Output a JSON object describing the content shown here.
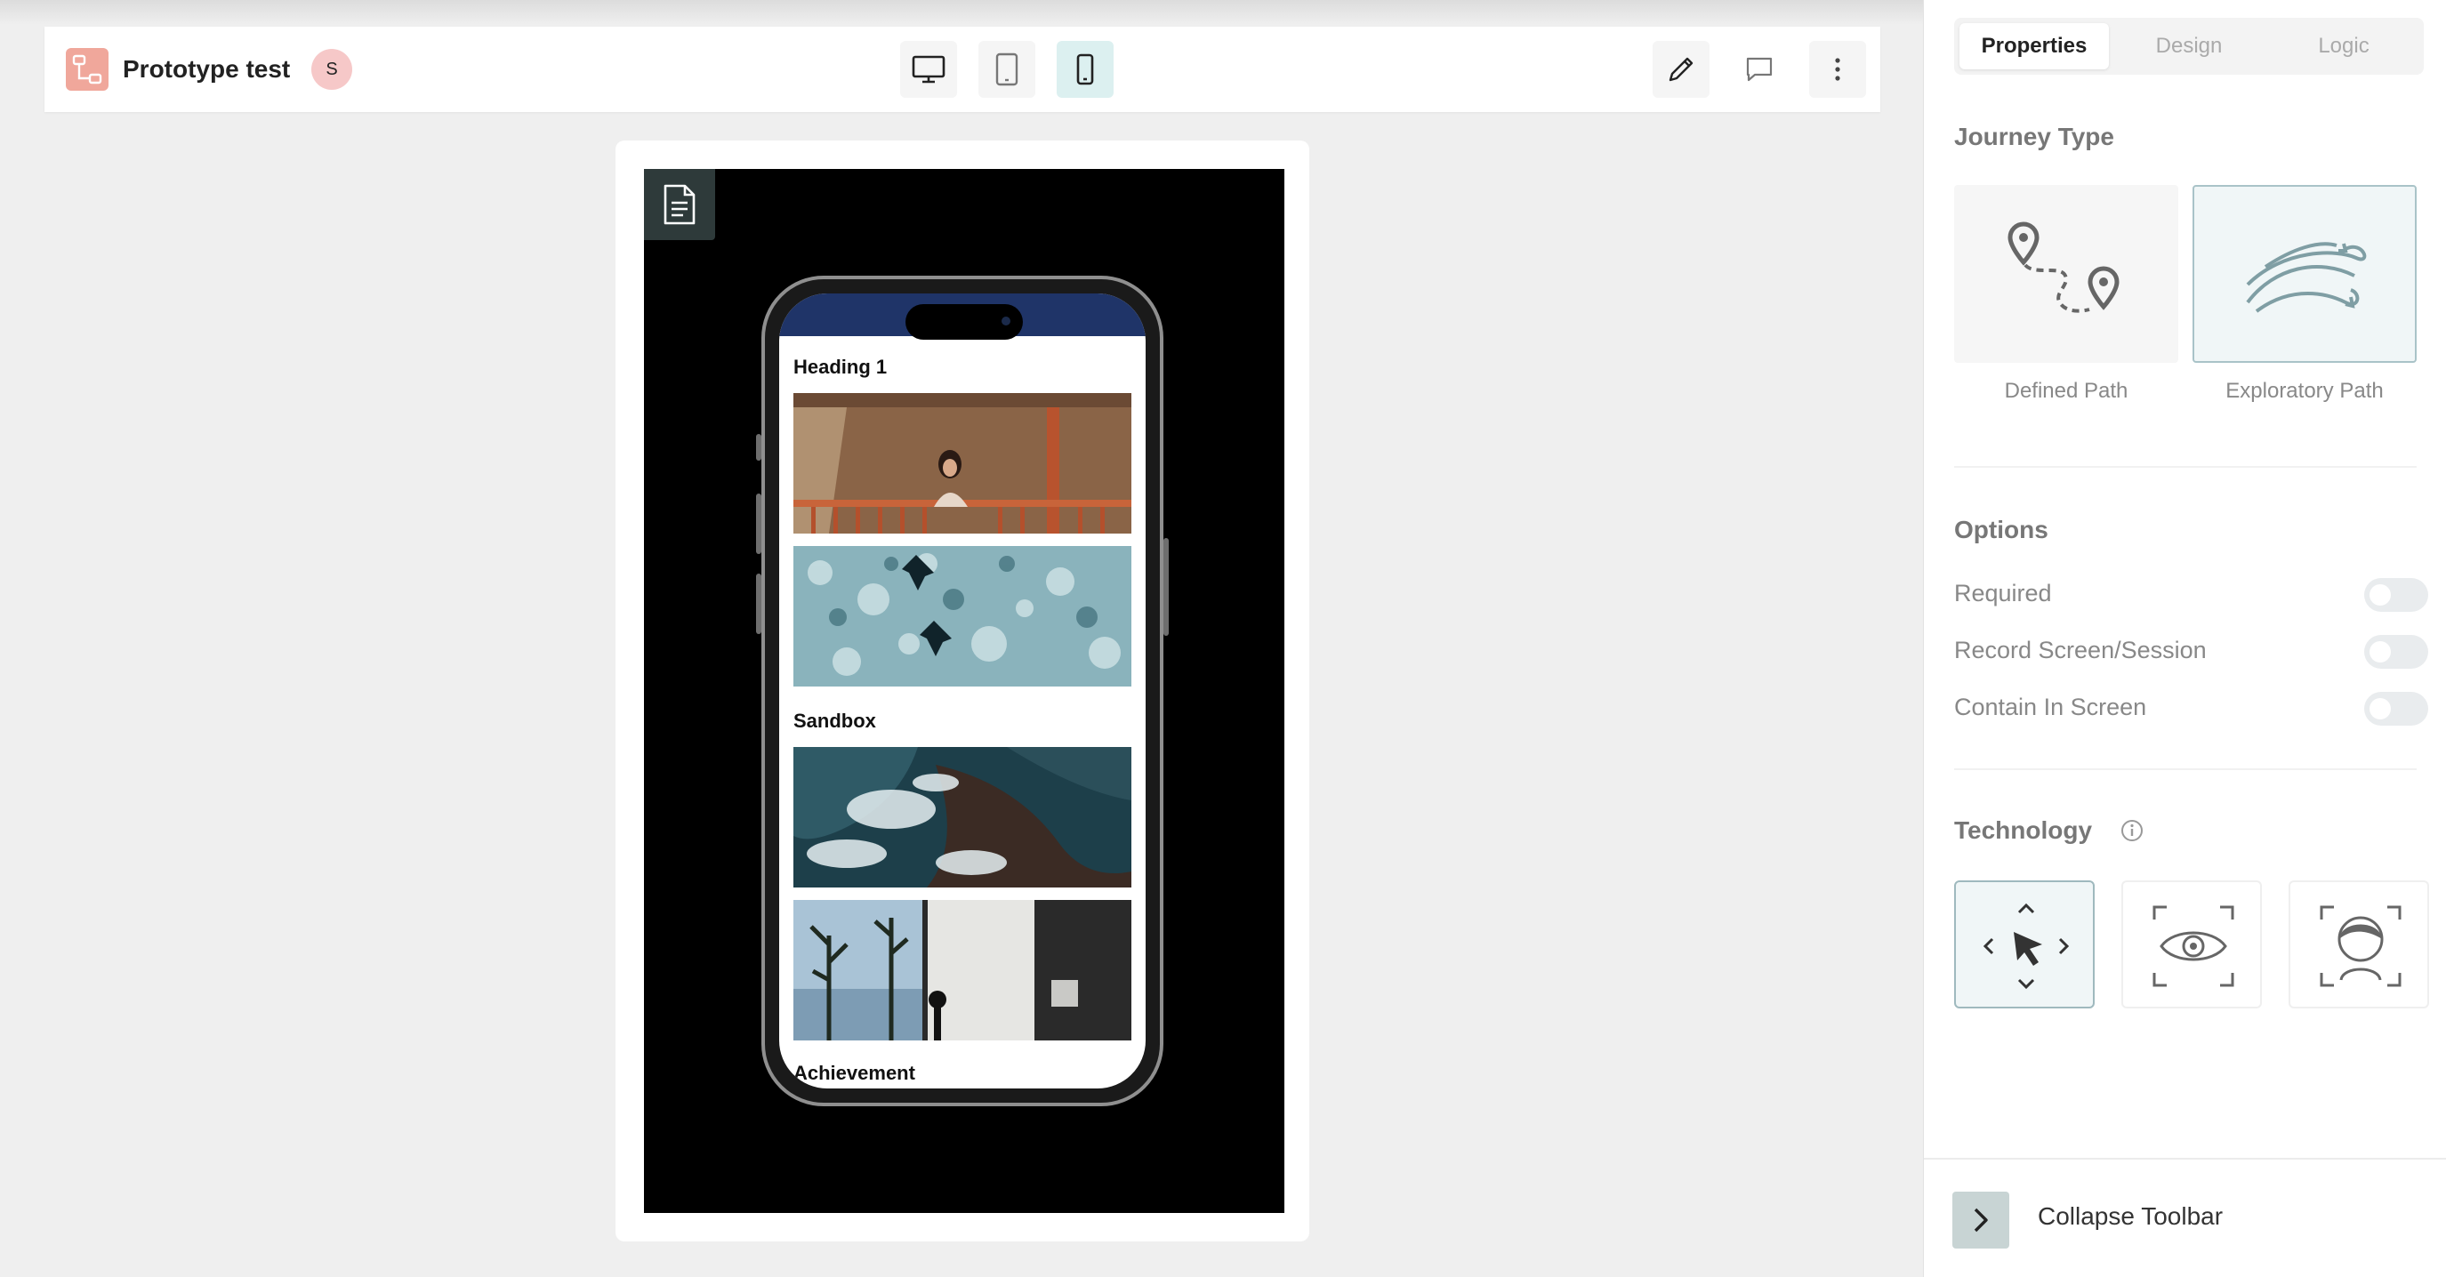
{
  "topbar": {
    "title": "Prototype test",
    "avatar_initial": "S"
  },
  "icons": {
    "app": "prototype-flow-icon",
    "desktop": "desktop-icon",
    "tablet": "tablet-icon",
    "mobile": "mobile-icon",
    "edit": "pencil-icon",
    "comment": "comment-icon",
    "more": "more-vertical-icon",
    "page": "document-icon"
  },
  "phone": {
    "heading1": "Heading 1",
    "sandbox": "Sandbox",
    "achievement": "Achievement"
  },
  "sidebar": {
    "tabs": [
      "Properties",
      "Design",
      "Logic"
    ],
    "active_tab": "Properties",
    "journey_type": {
      "title": "Journey Type",
      "options": [
        "Defined Path",
        "Exploratory Path"
      ],
      "selected": "Exploratory Path"
    },
    "options": {
      "title": "Options",
      "items": [
        {
          "label": "Required",
          "enabled": false
        },
        {
          "label": "Record Screen/Session",
          "enabled": false
        },
        {
          "label": "Contain In Screen",
          "enabled": false
        }
      ]
    },
    "technology": {
      "title": "Technology",
      "options": [
        "click-navigation-icon",
        "eye-tracking-icon",
        "face-tracking-icon"
      ],
      "selected": "click-navigation-icon"
    },
    "collapse_label": "Collapse Toolbar"
  },
  "colors": {
    "accent": "#dcf0f0",
    "app_icon": "#f0a79b",
    "selected_border": "#a9c3c8"
  }
}
